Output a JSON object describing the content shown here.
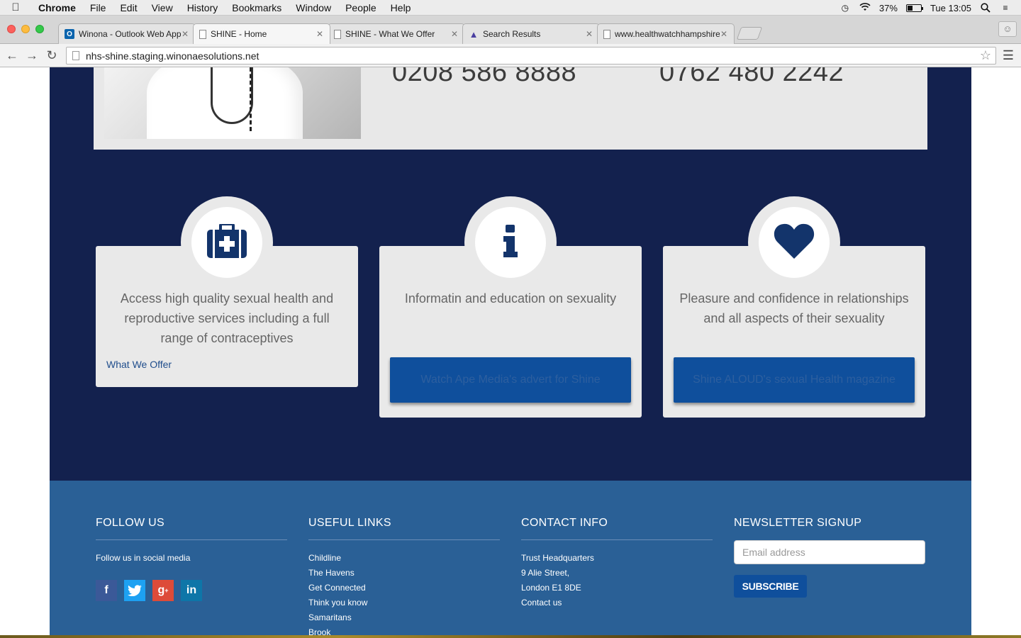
{
  "menubar": {
    "app": "Chrome",
    "items": [
      "File",
      "Edit",
      "View",
      "History",
      "Bookmarks",
      "Window",
      "People",
      "Help"
    ],
    "battery_percent": "37%",
    "battery_level": 0.37,
    "clock": "Tue 13:05"
  },
  "tabs": [
    {
      "title": "Winona - Outlook Web App",
      "icon": "outlook-icon",
      "active": false
    },
    {
      "title": "SHINE - Home",
      "icon": "page-icon",
      "active": true
    },
    {
      "title": "SHINE - What We Offer",
      "icon": "page-icon",
      "active": false
    },
    {
      "title": "Search Results",
      "icon": "search-results-icon",
      "active": false
    },
    {
      "title": "www.healthwatchhampshire",
      "icon": "page-icon",
      "active": false
    }
  ],
  "toolbar": {
    "url": "nhs-shine.staging.winonaesolutions.net"
  },
  "contact": {
    "phone_1": "0208 586 8888",
    "phone_2": "0762 480 2242"
  },
  "features": [
    {
      "icon": "medical-kit-icon",
      "text": "Access high quality sexual health and reproductive services including a full range of contraceptives",
      "link": "What We Offer"
    },
    {
      "icon": "info-icon",
      "text": "Informatin and education on sexuality",
      "button": "Watch Ape Media's advert for Shine"
    },
    {
      "icon": "heart-icon",
      "text": "Pleasure and confidence in relationships and all aspects of their sexuality",
      "button": "Shine ALOUD's sexual Health magazine"
    }
  ],
  "footer": {
    "follow": {
      "heading": "FOLLOW US",
      "text": "Follow us in social media",
      "socials": [
        "facebook-icon",
        "twitter-icon",
        "google-plus-icon",
        "linkedin-icon"
      ]
    },
    "links": {
      "heading": "USEFUL LINKS",
      "items": [
        "Childline",
        "The Havens",
        "Get Connected",
        "Think you know",
        "Samaritans",
        "Brook"
      ]
    },
    "contact": {
      "heading": "CONTACT INFO",
      "lines": [
        "Trust Headquarters",
        "9 Alie Street,",
        "London E1 8DE",
        "Contact us"
      ]
    },
    "newsletter": {
      "heading": "NEWSLETTER SIGNUP",
      "placeholder": "Email address",
      "button": "SUBSCRIBE"
    }
  },
  "colors": {
    "navy": "#13214e",
    "footer_blue": "#2a6096",
    "button_blue": "#0f4f9c",
    "card_grey": "#e9e9e9"
  }
}
